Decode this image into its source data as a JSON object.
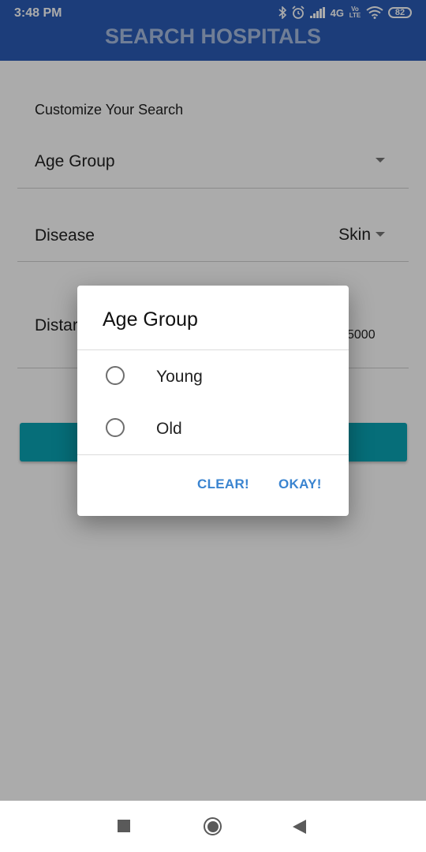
{
  "status_bar": {
    "time": "3:48 PM",
    "network": "4G",
    "volte": "Vo LTE",
    "battery": "82",
    "icons": [
      "bluetooth-icon",
      "alarm-icon",
      "signal-icon",
      "wifi-icon",
      "battery-icon"
    ]
  },
  "app_bar": {
    "title": "SEARCH HOSPITALS"
  },
  "form": {
    "subtitle": "Customize Your Search",
    "age_group_label": "Age Group",
    "disease_label": "Disease",
    "disease_value": "Skin",
    "distance_label": "Distar",
    "distance_value": "5000"
  },
  "dialog": {
    "title": "Age Group",
    "options": [
      "Young",
      "Old"
    ],
    "clear_label": "CLEAR!",
    "okay_label": "OKAY!"
  },
  "nav_bar": {
    "icons": [
      "recents-icon",
      "home-icon",
      "back-icon"
    ]
  },
  "colors": {
    "app_bar": "#2a5cb6",
    "accent_button": "#0aa5b5",
    "dialog_action": "#3a84d0"
  }
}
